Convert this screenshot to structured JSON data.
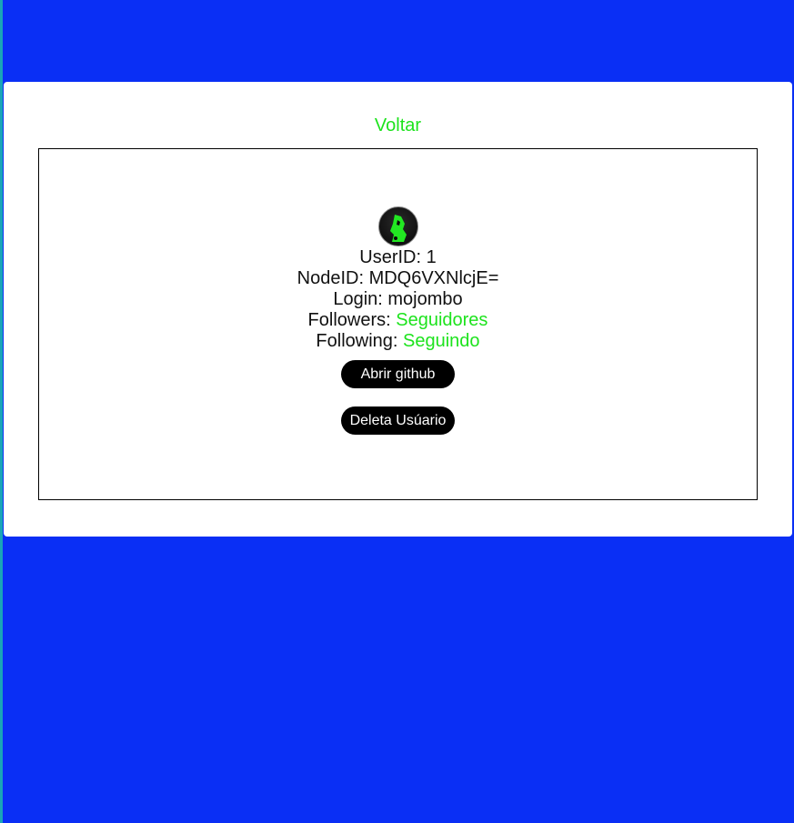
{
  "nav": {
    "back_label": "Voltar"
  },
  "user": {
    "avatar_icon": "user-avatar",
    "userid_label": "UserID:",
    "userid_value": "1",
    "nodeid_label": "NodeID:",
    "nodeid_value": "MDQ6VXNlcjE=",
    "login_label": "Login:",
    "login_value": "mojombo",
    "followers_label": "Followers:",
    "followers_link": "Seguidores",
    "following_label": "Following:",
    "following_link": "Seguindo"
  },
  "actions": {
    "open_github_label": "Abrir github",
    "delete_user_label": "Deleta Usúario"
  },
  "colors": {
    "background": "#0a2ff5",
    "link": "#1de31d",
    "button_bg": "#000000",
    "button_text": "#ffffff"
  }
}
